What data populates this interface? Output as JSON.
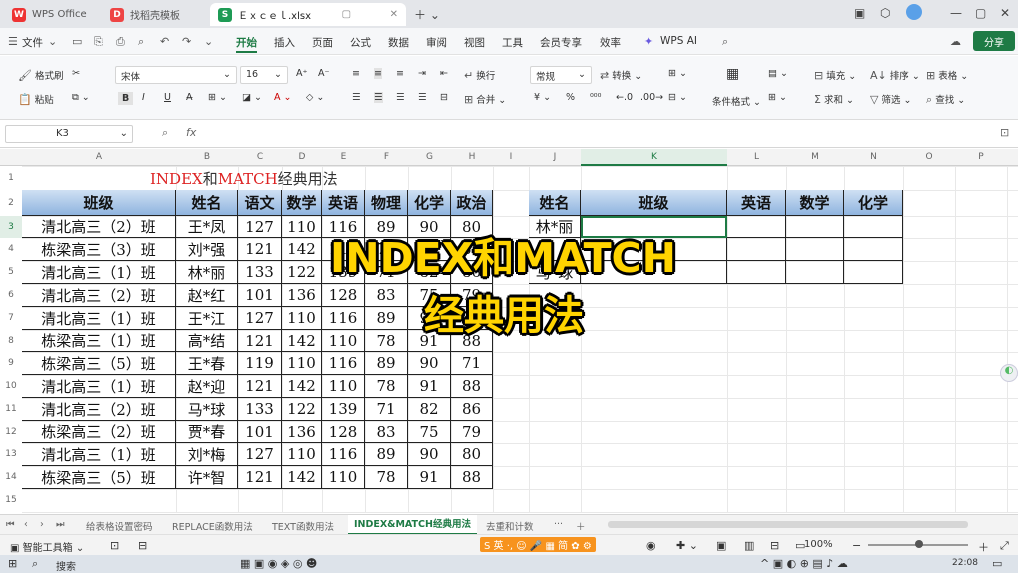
{
  "window": {
    "tabs": [
      {
        "label": "WPS Office",
        "icon": "wps-logo-icon"
      },
      {
        "label": "找稻壳模板",
        "icon": "docer-logo-icon"
      },
      {
        "label": "Ｅｘｃｅｌ.xlsx",
        "icon": "spreadsheet-logo-icon"
      }
    ]
  },
  "menu": {
    "file_label": "文件",
    "items": [
      "开始",
      "插入",
      "页面",
      "公式",
      "数据",
      "审阅",
      "视图",
      "工具",
      "会员专享",
      "效率"
    ],
    "active": "开始",
    "ai_label": "WPS AI",
    "share_label": "分享"
  },
  "ribbon": {
    "format_painter": "格式刷",
    "paste": "粘贴",
    "font_name": "宋体",
    "font_size": "16",
    "wrap": "换行",
    "merge": "合并",
    "number_format": "常规",
    "convert": "转换",
    "conditional": "条件格式",
    "fill": "填充",
    "sort": "排序",
    "sheet": "表格",
    "sum": "求和",
    "filter": "筛选",
    "find": "查找"
  },
  "formula_bar": {
    "cell_ref": "K3",
    "fx": "fx",
    "content": ""
  },
  "columns": [
    "A",
    "B",
    "C",
    "D",
    "E",
    "F",
    "G",
    "H",
    "I",
    "J",
    "K",
    "L",
    "M",
    "N",
    "O",
    "P"
  ],
  "rows": [
    "1",
    "2",
    "3",
    "4",
    "5",
    "6",
    "7",
    "8",
    "9",
    "10",
    "11",
    "12",
    "13",
    "14",
    "15"
  ],
  "selected": {
    "column": "K",
    "row": "3"
  },
  "sheet_title": {
    "part1": "INDEX",
    "part2": "和",
    "part3": "MATCH",
    "part4": "经典用法"
  },
  "left_table": {
    "headers": [
      "班级",
      "姓名",
      "语文",
      "数学",
      "英语",
      "物理",
      "化学",
      "政治"
    ],
    "rows": [
      [
        "清北高三（2）班",
        "王*凤",
        "127",
        "110",
        "116",
        "89",
        "90",
        "80"
      ],
      [
        "栋梁高三（3）班",
        "刘*强",
        "121",
        "142",
        "110",
        "78",
        "91",
        "88"
      ],
      [
        "清北高三（1）班",
        "林*丽",
        "133",
        "122",
        "139",
        "71",
        "82",
        "86"
      ],
      [
        "清北高三（2）班",
        "赵*红",
        "101",
        "136",
        "128",
        "83",
        "75",
        "79"
      ],
      [
        "清北高三（1）班",
        "王*江",
        "127",
        "110",
        "116",
        "89",
        "90",
        "80"
      ],
      [
        "栋梁高三（1）班",
        "高*结",
        "121",
        "142",
        "110",
        "78",
        "91",
        "88"
      ],
      [
        "栋梁高三（5）班",
        "王*春",
        "119",
        "110",
        "116",
        "89",
        "90",
        "71"
      ],
      [
        "清北高三（1）班",
        "赵*迎",
        "121",
        "142",
        "110",
        "78",
        "91",
        "88"
      ],
      [
        "清北高三（2）班",
        "马*球",
        "133",
        "122",
        "139",
        "71",
        "82",
        "86"
      ],
      [
        "栋梁高三（2）班",
        "贾*春",
        "101",
        "136",
        "128",
        "83",
        "75",
        "79"
      ],
      [
        "清北高三（1）班",
        "刘*梅",
        "127",
        "110",
        "116",
        "89",
        "90",
        "80"
      ],
      [
        "栋梁高三（5）班",
        "许*智",
        "121",
        "142",
        "110",
        "78",
        "91",
        "88"
      ]
    ]
  },
  "right_table": {
    "headers": [
      "姓名",
      "班级",
      "英语",
      "数学",
      "化学"
    ],
    "names": [
      "林*丽",
      "",
      "马*球"
    ]
  },
  "overlay": {
    "line1": "INDEX和MATCH",
    "line2": "经典用法"
  },
  "sheet_tabs": {
    "tabs": [
      "给表格设置密码",
      "REPLACE函数用法",
      "TEXT函数用法",
      "INDEX&MATCH经典用法",
      "去重和计数"
    ],
    "active": "INDEX&MATCH经典用法"
  },
  "status": {
    "left": "智能工具箱",
    "zoom": "100%"
  },
  "taskbar": {
    "search": "搜索",
    "time": "22:08"
  }
}
